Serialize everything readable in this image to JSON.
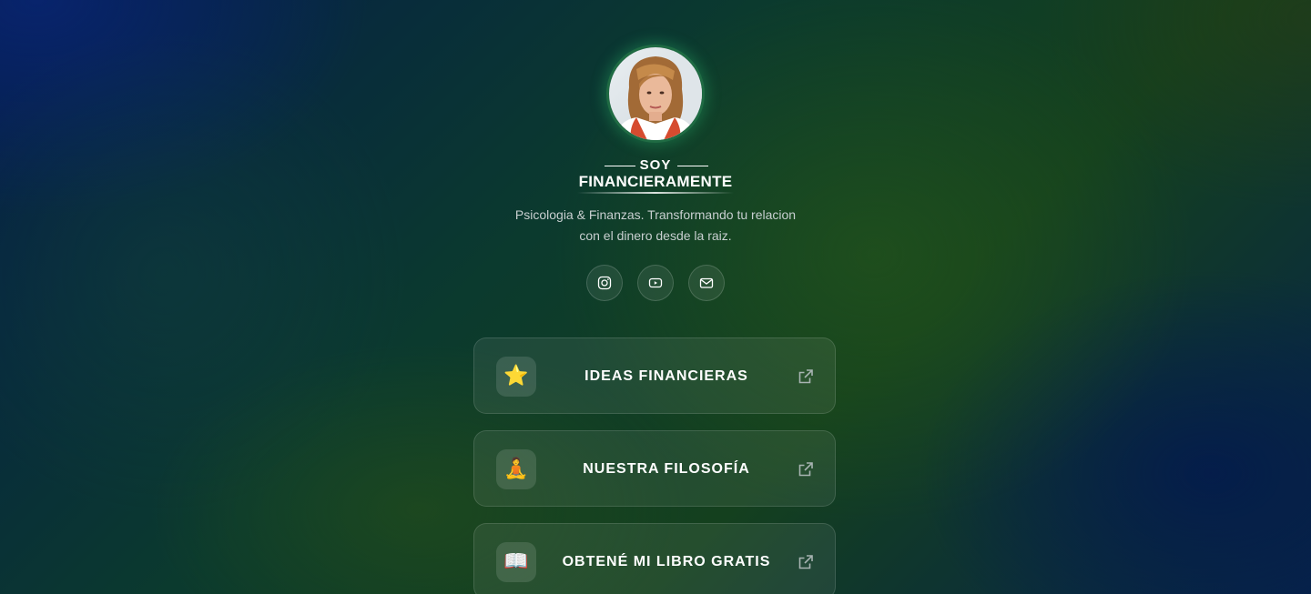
{
  "profile": {
    "avatar_alt": "Foto de perfil",
    "brand_top": "SOY",
    "brand_main": "FINANCIERAMENTE",
    "bio_line1": "Psicologia & Finanzas. Transformando tu relacion",
    "bio_line2": "con el dinero desde la raiz."
  },
  "social": [
    {
      "icon": "instagram-icon"
    },
    {
      "icon": "youtube-icon"
    },
    {
      "icon": "mail-icon"
    }
  ],
  "links": [
    {
      "emoji": "⭐",
      "label": "IDEAS FINANCIERAS",
      "icon": "star-icon"
    },
    {
      "emoji": "🧘",
      "label": "NUESTRA FILOSOFÍA",
      "icon": "meditation-icon"
    },
    {
      "emoji": "📖",
      "label": "OBTENÉ MI LIBRO GRATIS",
      "icon": "book-icon"
    }
  ],
  "colors": {
    "accent_ring": "#1f6b43",
    "card_bg": "rgba(255,255,255,0.075)",
    "text_primary": "#ffffff",
    "text_secondary": "#c8cfd0"
  }
}
